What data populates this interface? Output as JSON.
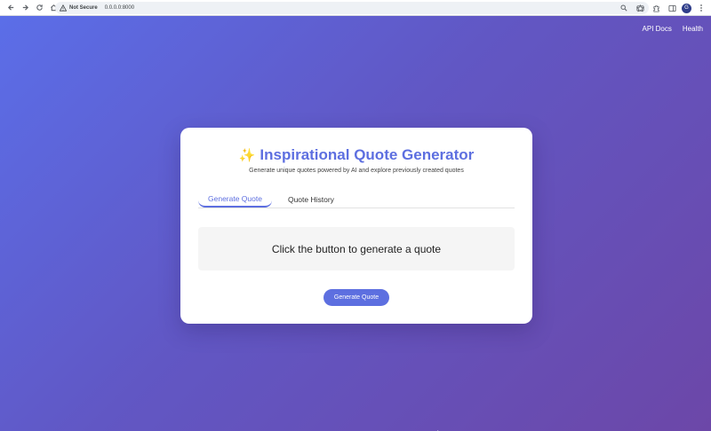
{
  "browser": {
    "security_label": "Not Secure",
    "url": "0.0.0.0:8000",
    "avatar_initial": "G"
  },
  "header": {
    "links": [
      "API Docs",
      "Health"
    ]
  },
  "card": {
    "title_emoji": "✨",
    "title": "Inspirational Quote Generator",
    "subtitle": "Generate unique quotes powered by AI and explore previously created quotes",
    "tabs": [
      {
        "label": "Generate Quote",
        "active": true
      },
      {
        "label": "Quote History",
        "active": false
      }
    ],
    "placeholder": "Click the button to generate a quote",
    "button_label": "Generate Quote"
  },
  "colors": {
    "accent": "#5d6fe0",
    "gradient_start": "#5b6ee8",
    "gradient_end": "#6c47a8"
  }
}
